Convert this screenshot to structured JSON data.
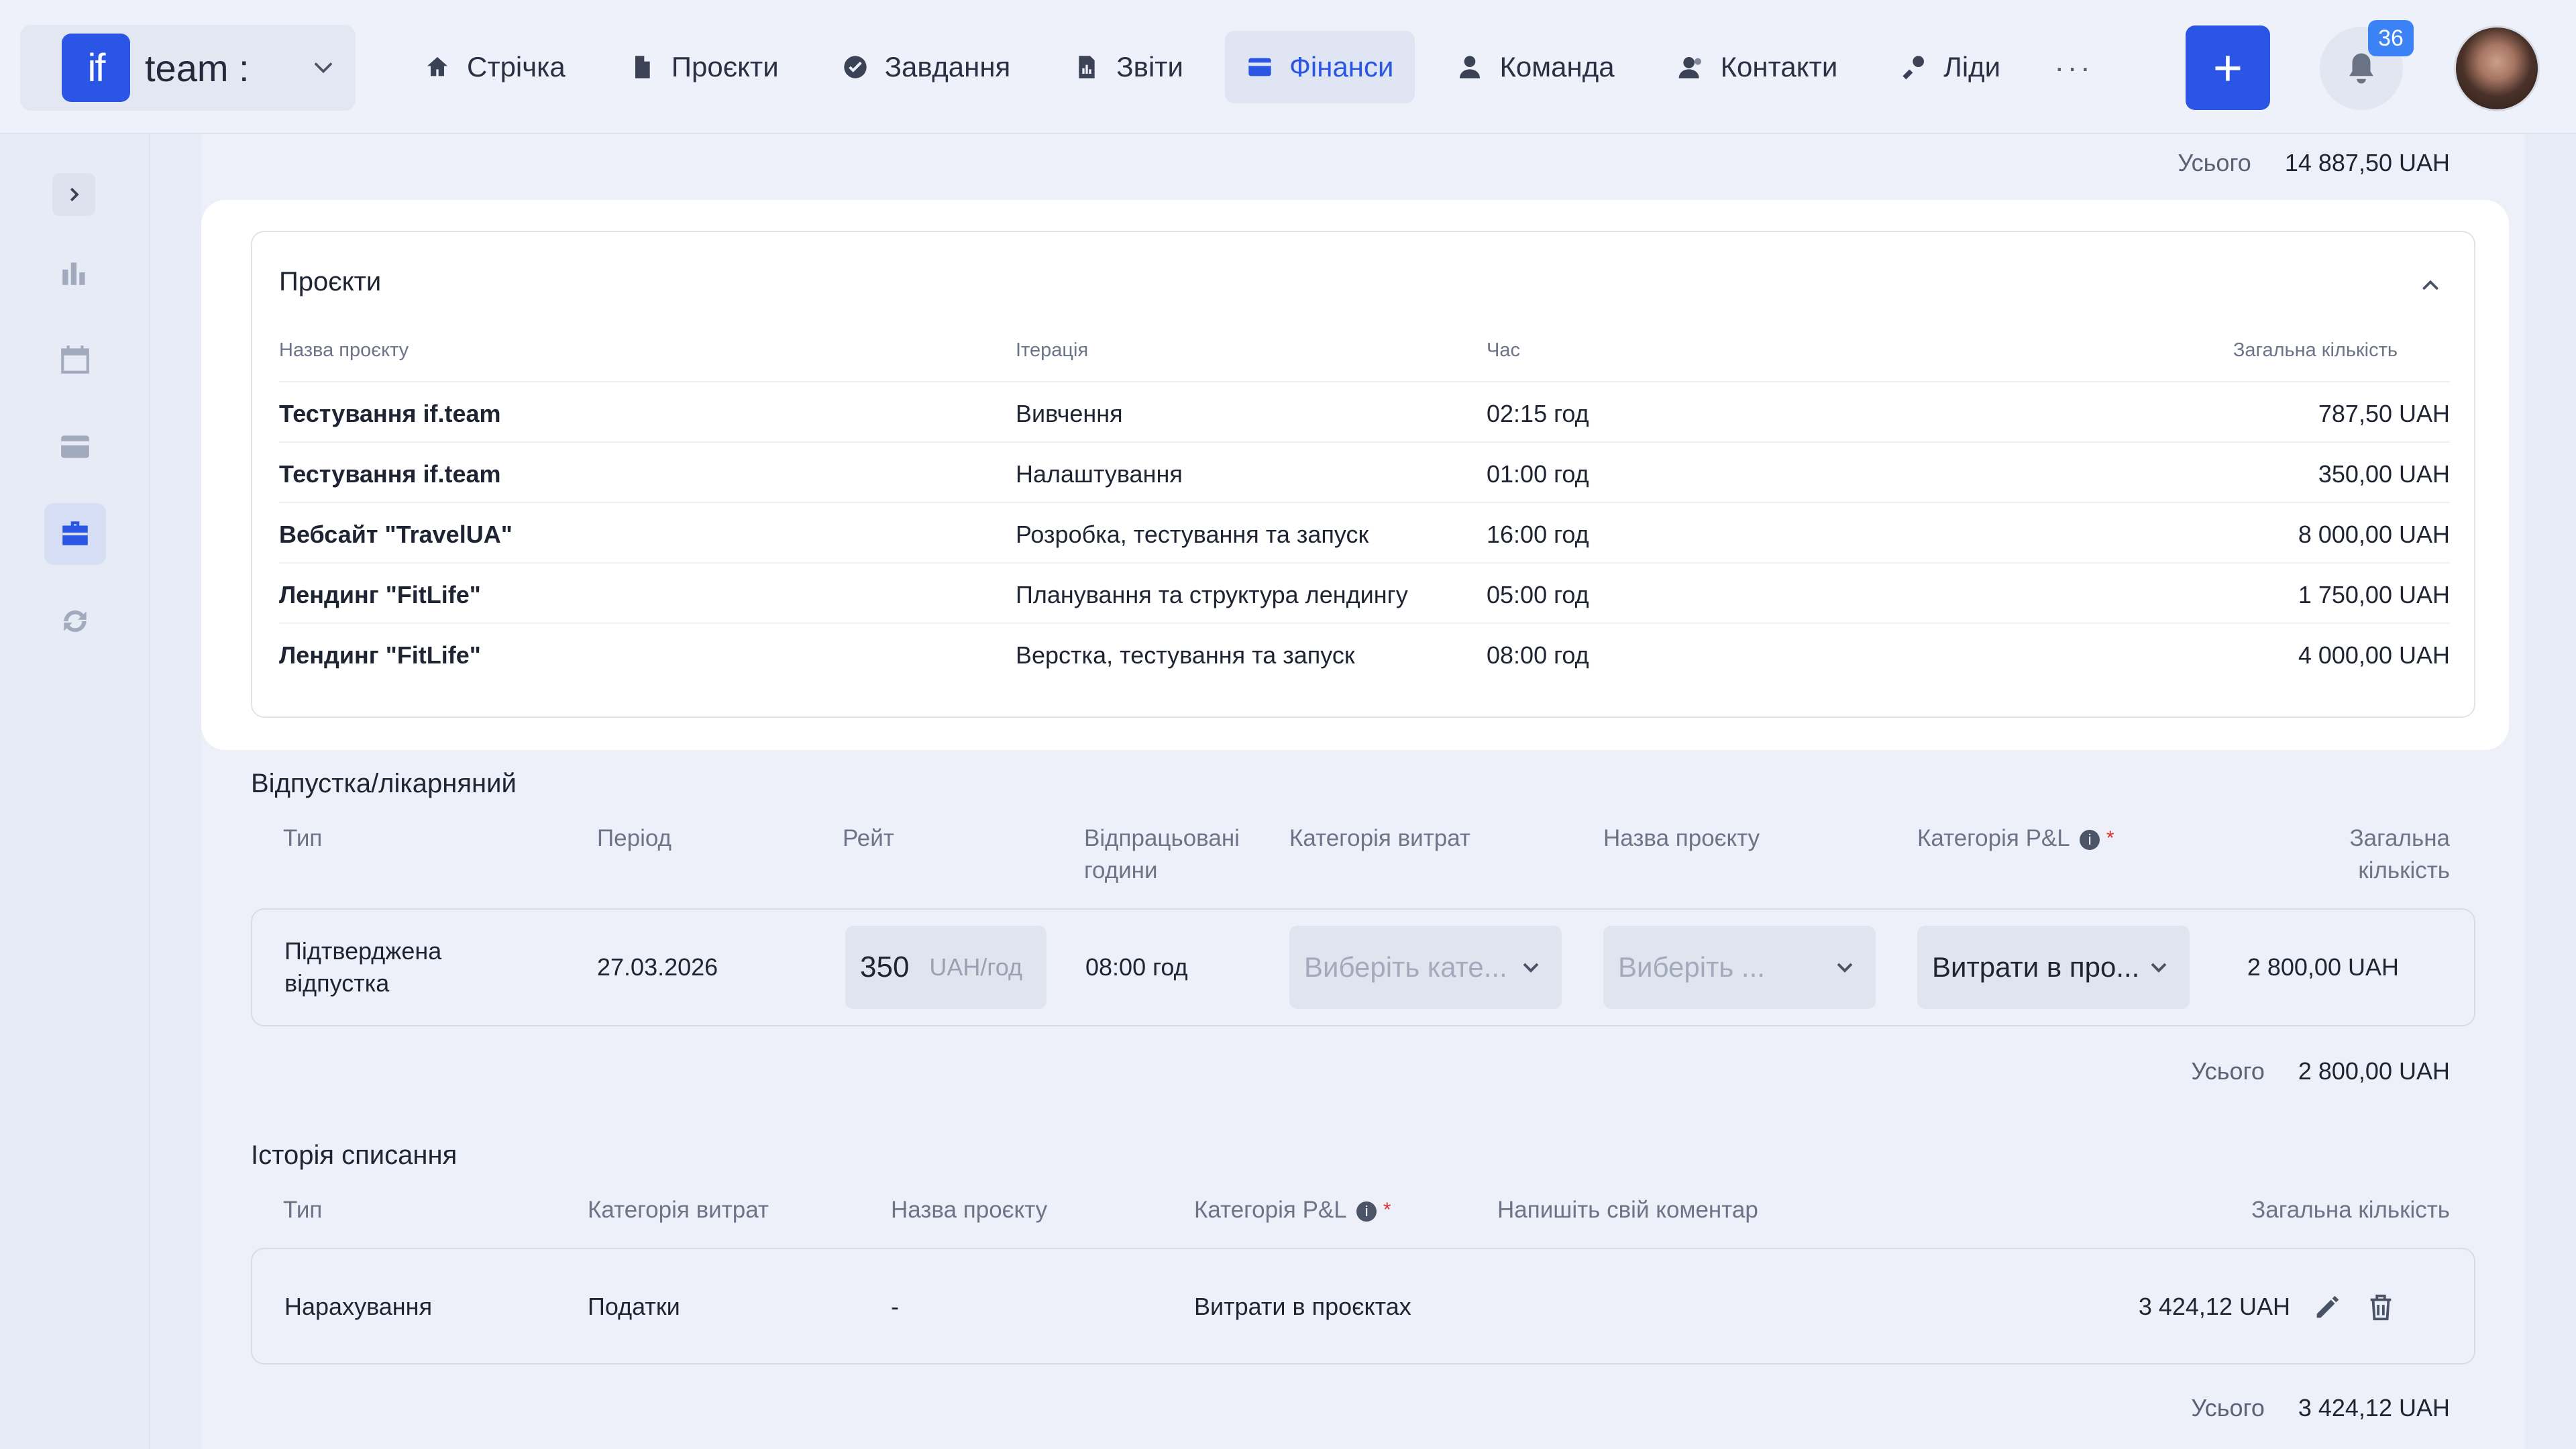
{
  "header": {
    "brand_logo": "if",
    "brand_name": "team :",
    "nav": [
      {
        "label": "Стрічка",
        "icon": "home-icon"
      },
      {
        "label": "Проєкти",
        "icon": "document-icon"
      },
      {
        "label": "Завдання",
        "icon": "check-circle-icon"
      },
      {
        "label": "Звіти",
        "icon": "report-icon"
      },
      {
        "label": "Фінанси",
        "icon": "wallet-icon",
        "active": true
      },
      {
        "label": "Команда",
        "icon": "user-icon"
      },
      {
        "label": "Контакти",
        "icon": "contacts-icon"
      },
      {
        "label": "Ліди",
        "icon": "leads-icon"
      }
    ],
    "more_label": "···",
    "add_label": "+",
    "notification_count": "36"
  },
  "top_total": {
    "label": "Усього",
    "value": "14 887,50 UAH"
  },
  "projects": {
    "title": "Проєкти",
    "columns": [
      "Назва проєкту",
      "Ітерація",
      "Час",
      "Загальна кількість"
    ],
    "rows": [
      {
        "name": "Тестування if.team",
        "iteration": "Вивчення",
        "time": "02:15 год",
        "amount": "787,50 UAH"
      },
      {
        "name": "Тестування if.team",
        "iteration": "Налаштування",
        "time": "01:00 год",
        "amount": "350,00 UAH"
      },
      {
        "name": "Вебсайт \"TravelUA\"",
        "iteration": "Розробка, тестування та запуск",
        "time": "16:00 год",
        "amount": "8 000,00 UAH"
      },
      {
        "name": "Лендинг \"FitLife\"",
        "iteration": "Планування та структура лендингу",
        "time": "05:00 год",
        "amount": "1 750,00 UAH"
      },
      {
        "name": "Лендинг \"FitLife\"",
        "iteration": "Верстка, тестування та запуск",
        "time": "08:00 год",
        "amount": "4 000,00 UAH"
      }
    ]
  },
  "leave": {
    "title": "Відпустка/лікарняний",
    "columns": {
      "type": "Тип",
      "period": "Період",
      "rate": "Рейт",
      "hours_1": "Відпрацьовані",
      "hours_2": "години",
      "expense_category": "Категорія витрат",
      "project_name": "Назва проєкту",
      "pl_category": "Категорія P&L",
      "total_1": "Загальна",
      "total_2": "кількість"
    },
    "row": {
      "type_1": "Підтверджена",
      "type_2": "відпустка",
      "period": "27.03.2026",
      "rate_value": "350",
      "rate_unit": "UAH/год",
      "hours": "08:00 год",
      "expense_placeholder": "Виберіть кате...",
      "project_placeholder": "Виберіть ...",
      "pl_value": "Витрати в про...",
      "total": "2 800,00 UAH"
    },
    "total_label": "Усього",
    "total_value": "2 800,00 UAH"
  },
  "writeoff": {
    "title": "Історія списання",
    "columns": {
      "type": "Тип",
      "expense_category": "Категорія витрат",
      "project_name": "Назва проєкту",
      "pl_category": "Категорія P&L",
      "comment": "Напишіть свій коментар",
      "total": "Загальна кількість"
    },
    "row": {
      "type": "Нарахування",
      "expense_category": "Податки",
      "project_name": "-",
      "pl_category": "Витрати в проєктах",
      "amount": "3 424,12 UAH"
    },
    "total_label": "Усього",
    "total_value": "3 424,12 UAH"
  },
  "ui": {
    "info_glyph": "i",
    "required_mark": "*"
  }
}
